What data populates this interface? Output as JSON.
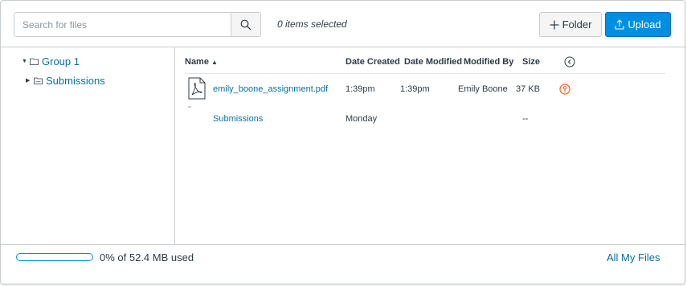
{
  "toolbar": {
    "search_placeholder": "Search for files",
    "search_icon": "search-icon",
    "selected_text": "0 items selected",
    "folder_label": "Folder",
    "folder_icon": "plus-icon",
    "upload_label": "Upload",
    "upload_icon": "upload-icon"
  },
  "tree": {
    "root": {
      "label": "Group 1",
      "expanded": true,
      "icon": "folder-open-icon"
    },
    "children": [
      {
        "label": "Submissions",
        "expanded": false,
        "icon": "folder-icon"
      }
    ]
  },
  "table": {
    "headers": {
      "name": "Name",
      "name_sort": "▲",
      "created": "Date Created",
      "modified": "Date Modified",
      "modified_by": "Modified By",
      "size": "Size",
      "actions_icon": "column-menu-icon"
    },
    "rows": [
      {
        "icon": "pdf-file-icon",
        "name": "emily_boone_assignment.pdf",
        "created": "1:39pm",
        "modified": "1:39pm",
        "modified_by": "Emily Boone",
        "size": "37 KB",
        "status_icon": "restricted-access-icon"
      },
      {
        "icon": "folder-icon",
        "name": "Submissions",
        "created": "Monday",
        "modified": "",
        "modified_by": "",
        "size": "--"
      }
    ]
  },
  "footer": {
    "quota_text": "0% of 52.4 MB used",
    "quota_fraction": 0.0,
    "all_files_link": "All My Files"
  },
  "colors": {
    "accent": "#008ee2",
    "link": "#0770a3",
    "text": "#2d3b45",
    "warning": "#fc5e13",
    "border": "#c7cdd1"
  }
}
